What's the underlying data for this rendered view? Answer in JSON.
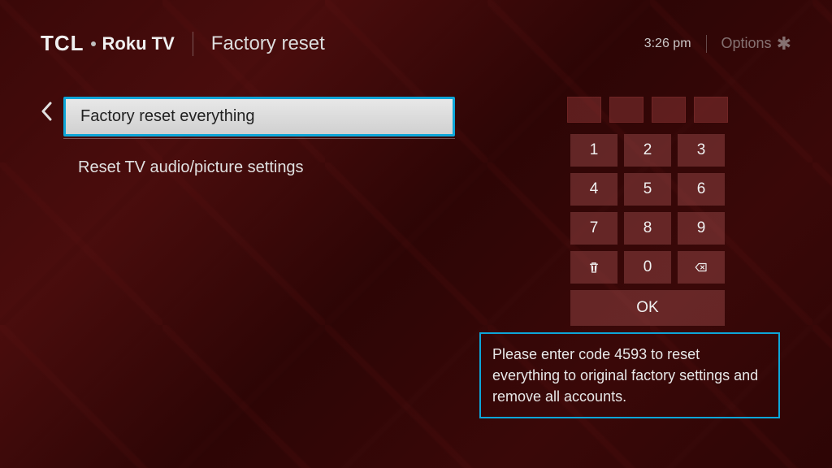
{
  "header": {
    "brand1": "TCL",
    "brand2": "Roku TV",
    "title": "Factory reset",
    "clock": "3:26 pm",
    "options_label": "Options"
  },
  "menu": {
    "items": [
      {
        "label": "Factory reset everything",
        "selected": true
      },
      {
        "label": "Reset TV audio/picture settings",
        "selected": false
      }
    ]
  },
  "keypad": {
    "keys": [
      "1",
      "2",
      "3",
      "4",
      "5",
      "6",
      "7",
      "8",
      "9"
    ],
    "zero": "0",
    "ok_label": "OK"
  },
  "instruction_text": "Please enter code 4593 to reset everything to original factory settings and remove all accounts."
}
